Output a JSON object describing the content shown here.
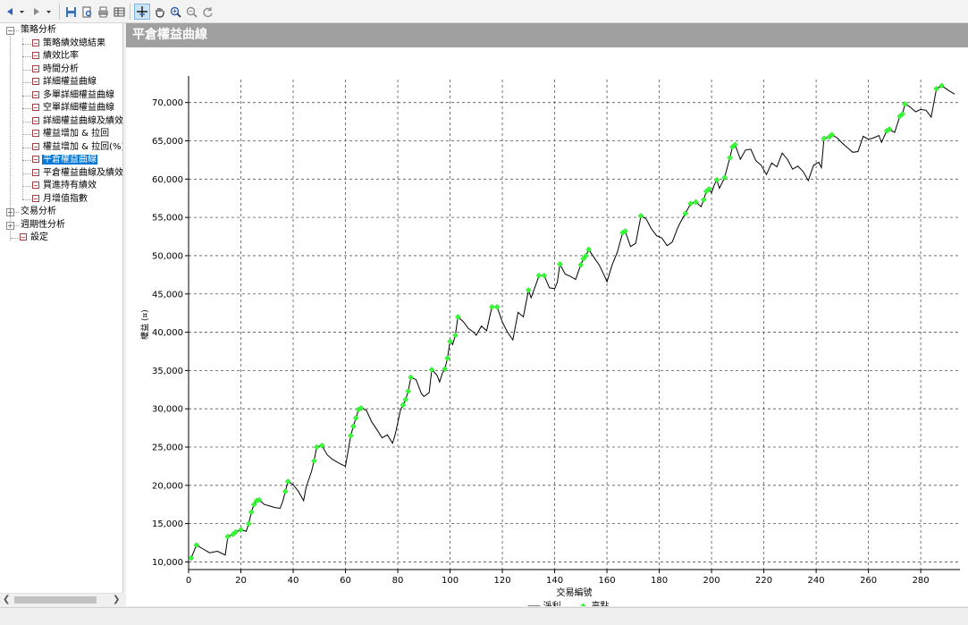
{
  "toolbar": {
    "buttons": [
      {
        "name": "back-button",
        "icon": "arrow-left-icon"
      },
      {
        "name": "back-dropdown",
        "icon": "chevron-down-icon"
      },
      {
        "name": "forward-button",
        "icon": "arrow-right-icon"
      },
      {
        "name": "forward-dropdown",
        "icon": "chevron-down-icon"
      },
      {
        "name": "save-button",
        "icon": "save-icon"
      },
      {
        "name": "print-preview-button",
        "icon": "print-preview-icon"
      },
      {
        "name": "print-button",
        "icon": "printer-icon"
      },
      {
        "name": "data-table-button",
        "icon": "table-icon"
      },
      {
        "name": "crosshair-tool-button",
        "icon": "crosshair-icon",
        "active": true
      },
      {
        "name": "pan-tool-button",
        "icon": "hand-icon"
      },
      {
        "name": "zoom-in-button",
        "icon": "zoom-in-icon"
      },
      {
        "name": "zoom-out-button",
        "icon": "zoom-out-icon"
      },
      {
        "name": "reset-view-button",
        "icon": "refresh-icon"
      }
    ]
  },
  "sidebar": {
    "tree": [
      {
        "label": "策略分析",
        "level": 0,
        "expanded": true,
        "children": [
          {
            "label": "策略績效總結果"
          },
          {
            "label": "績效比率"
          },
          {
            "label": "時間分析"
          },
          {
            "label": "詳細權益曲線"
          },
          {
            "label": "多單詳細權益曲線"
          },
          {
            "label": "空單詳細權益曲線"
          },
          {
            "label": "詳細權益曲線及績效"
          },
          {
            "label": "權益增加 & 拉回"
          },
          {
            "label": "權益增加 & 拉回(%)"
          },
          {
            "label": "平倉權益曲線",
            "selected": true
          },
          {
            "label": "平倉權益曲線及績效"
          },
          {
            "label": "買進持有績效"
          },
          {
            "label": "月增值指數"
          }
        ]
      },
      {
        "label": "交易分析",
        "level": 0,
        "expanded": false
      },
      {
        "label": "週期性分析",
        "level": 0,
        "expanded": false
      },
      {
        "label": "設定",
        "level": 0,
        "leaf": true
      }
    ]
  },
  "main": {
    "title": "平倉權益曲線"
  },
  "colors": {
    "header_bg": "#a0a0a0",
    "line": "#000000",
    "highs": "#33ff33",
    "selected": "#0078d7"
  },
  "chart_data": {
    "type": "line",
    "xlabel": "交易編號",
    "ylabel": "權益 (¤)",
    "xlim": [
      0,
      295
    ],
    "ylim": [
      9000,
      73000
    ],
    "xticks": [
      0,
      20,
      40,
      60,
      80,
      100,
      120,
      140,
      160,
      180,
      200,
      220,
      240,
      260,
      280
    ],
    "yticks": [
      10000,
      15000,
      20000,
      25000,
      30000,
      35000,
      40000,
      45000,
      50000,
      55000,
      60000,
      65000,
      70000
    ],
    "ytick_labels": [
      "10,000",
      "15,000",
      "20,000",
      "25,000",
      "30,000",
      "35,000",
      "40,000",
      "45,000",
      "50,000",
      "55,000",
      "60,000",
      "65,000",
      "70,000"
    ],
    "grid": true,
    "legend": {
      "position": "bottom-center",
      "entries": [
        {
          "label": "淨利",
          "marker": "line"
        },
        {
          "label": "高點",
          "marker": "diamond"
        }
      ]
    },
    "series": [
      {
        "name": "淨利",
        "type": "line",
        "points": [
          [
            1,
            10500
          ],
          [
            3,
            12200
          ],
          [
            5,
            11800
          ],
          [
            8,
            11200
          ],
          [
            11,
            11400
          ],
          [
            14,
            10900
          ],
          [
            15,
            13300
          ],
          [
            17,
            13600
          ],
          [
            18,
            13900
          ],
          [
            20,
            14200
          ],
          [
            22,
            14000
          ],
          [
            23,
            15000
          ],
          [
            24,
            16500
          ],
          [
            25,
            17500
          ],
          [
            26,
            18000
          ],
          [
            27,
            18100
          ],
          [
            29,
            17500
          ],
          [
            31,
            17300
          ],
          [
            33,
            17100
          ],
          [
            35,
            17000
          ],
          [
            36,
            17900
          ],
          [
            37,
            19200
          ],
          [
            38,
            20500
          ],
          [
            40,
            20100
          ],
          [
            42,
            19200
          ],
          [
            44,
            18000
          ],
          [
            45,
            19800
          ],
          [
            47,
            21800
          ],
          [
            48,
            23200
          ],
          [
            49,
            25000
          ],
          [
            51,
            25200
          ],
          [
            53,
            24000
          ],
          [
            55,
            23400
          ],
          [
            58,
            22800
          ],
          [
            60,
            22500
          ],
          [
            61,
            24500
          ],
          [
            62,
            26500
          ],
          [
            63,
            27700
          ],
          [
            64,
            28800
          ],
          [
            65,
            29900
          ],
          [
            66,
            30100
          ],
          [
            68,
            29800
          ],
          [
            70,
            28300
          ],
          [
            72,
            27300
          ],
          [
            74,
            26200
          ],
          [
            76,
            26600
          ],
          [
            78,
            25500
          ],
          [
            79,
            26600
          ],
          [
            81,
            29800
          ],
          [
            82,
            30500
          ],
          [
            83,
            31200
          ],
          [
            84,
            32300
          ],
          [
            85,
            34100
          ],
          [
            87,
            33800
          ],
          [
            89,
            32000
          ],
          [
            90,
            31600
          ],
          [
            92,
            32100
          ],
          [
            93,
            35100
          ],
          [
            95,
            34400
          ],
          [
            96,
            33500
          ],
          [
            97,
            34600
          ],
          [
            98,
            35200
          ],
          [
            99,
            36600
          ],
          [
            100,
            38800
          ],
          [
            101,
            38400
          ],
          [
            102,
            39600
          ],
          [
            103,
            42000
          ],
          [
            105,
            41400
          ],
          [
            107,
            40500
          ],
          [
            109,
            40000
          ],
          [
            110,
            39600
          ],
          [
            112,
            40800
          ],
          [
            114,
            40200
          ],
          [
            116,
            43300
          ],
          [
            118,
            43300
          ],
          [
            120,
            41300
          ],
          [
            122,
            40000
          ],
          [
            124,
            39000
          ],
          [
            126,
            42600
          ],
          [
            128,
            42000
          ],
          [
            130,
            45500
          ],
          [
            131,
            44500
          ],
          [
            133,
            46400
          ],
          [
            134,
            47400
          ],
          [
            136,
            47400
          ],
          [
            138,
            45800
          ],
          [
            140,
            45700
          ],
          [
            141,
            46500
          ],
          [
            142,
            48900
          ],
          [
            144,
            47600
          ],
          [
            146,
            47300
          ],
          [
            148,
            46900
          ],
          [
            150,
            48800
          ],
          [
            151,
            49600
          ],
          [
            152,
            50000
          ],
          [
            153,
            50800
          ],
          [
            155,
            49800
          ],
          [
            157,
            48800
          ],
          [
            159,
            47400
          ],
          [
            160,
            46600
          ],
          [
            162,
            48800
          ],
          [
            164,
            50500
          ],
          [
            166,
            53000
          ],
          [
            167,
            53200
          ],
          [
            169,
            51200
          ],
          [
            171,
            51600
          ],
          [
            173,
            55200
          ],
          [
            175,
            54800
          ],
          [
            177,
            53500
          ],
          [
            179,
            52600
          ],
          [
            181,
            52300
          ],
          [
            183,
            51300
          ],
          [
            185,
            51800
          ],
          [
            187,
            53600
          ],
          [
            188,
            54300
          ],
          [
            190,
            55500
          ],
          [
            192,
            56800
          ],
          [
            194,
            57000
          ],
          [
            196,
            56400
          ],
          [
            197,
            57300
          ],
          [
            198,
            58400
          ],
          [
            199,
            58700
          ],
          [
            200,
            58200
          ],
          [
            201,
            59200
          ],
          [
            202,
            59900
          ],
          [
            203,
            58800
          ],
          [
            205,
            60200
          ],
          [
            207,
            62800
          ],
          [
            208,
            64200
          ],
          [
            209,
            64500
          ],
          [
            211,
            62600
          ],
          [
            213,
            63800
          ],
          [
            215,
            63900
          ],
          [
            217,
            62400
          ],
          [
            219,
            61800
          ],
          [
            221,
            60600
          ],
          [
            223,
            62100
          ],
          [
            225,
            61600
          ],
          [
            227,
            63400
          ],
          [
            229,
            62600
          ],
          [
            231,
            61300
          ],
          [
            233,
            61700
          ],
          [
            235,
            61000
          ],
          [
            237,
            59800
          ],
          [
            239,
            61800
          ],
          [
            241,
            62200
          ],
          [
            242,
            61500
          ],
          [
            243,
            65300
          ],
          [
            245,
            65500
          ],
          [
            246,
            65800
          ],
          [
            248,
            65400
          ],
          [
            250,
            64700
          ],
          [
            252,
            64100
          ],
          [
            254,
            63500
          ],
          [
            256,
            63600
          ],
          [
            258,
            65600
          ],
          [
            260,
            65200
          ],
          [
            262,
            65400
          ],
          [
            264,
            65700
          ],
          [
            265,
            64800
          ],
          [
            267,
            66300
          ],
          [
            268,
            66500
          ],
          [
            270,
            66100
          ],
          [
            272,
            68200
          ],
          [
            273,
            68500
          ],
          [
            274,
            69800
          ],
          [
            276,
            69400
          ],
          [
            278,
            68800
          ],
          [
            280,
            69100
          ],
          [
            282,
            69000
          ],
          [
            284,
            68100
          ],
          [
            286,
            71800
          ],
          [
            288,
            72200
          ],
          [
            291,
            71500
          ],
          [
            293,
            71100
          ]
        ]
      },
      {
        "name": "高點",
        "type": "scatter",
        "points": [
          [
            1,
            10500
          ],
          [
            3,
            12200
          ],
          [
            15,
            13300
          ],
          [
            17,
            13600
          ],
          [
            18,
            13900
          ],
          [
            20,
            14200
          ],
          [
            23,
            15000
          ],
          [
            24,
            16500
          ],
          [
            25,
            17500
          ],
          [
            26,
            18000
          ],
          [
            27,
            18100
          ],
          [
            37,
            19200
          ],
          [
            38,
            20500
          ],
          [
            48,
            23200
          ],
          [
            49,
            25000
          ],
          [
            51,
            25200
          ],
          [
            62,
            26500
          ],
          [
            63,
            27700
          ],
          [
            64,
            28800
          ],
          [
            65,
            29900
          ],
          [
            66,
            30100
          ],
          [
            82,
            30500
          ],
          [
            83,
            31200
          ],
          [
            84,
            32300
          ],
          [
            85,
            34100
          ],
          [
            93,
            35100
          ],
          [
            98,
            35200
          ],
          [
            99,
            36600
          ],
          [
            100,
            38800
          ],
          [
            102,
            39600
          ],
          [
            103,
            42000
          ],
          [
            116,
            43300
          ],
          [
            118,
            43300
          ],
          [
            130,
            45500
          ],
          [
            134,
            47400
          ],
          [
            136,
            47400
          ],
          [
            142,
            48900
          ],
          [
            150,
            48800
          ],
          [
            151,
            49600
          ],
          [
            152,
            50000
          ],
          [
            153,
            50800
          ],
          [
            166,
            53000
          ],
          [
            167,
            53200
          ],
          [
            173,
            55200
          ],
          [
            190,
            55500
          ],
          [
            192,
            56800
          ],
          [
            194,
            57000
          ],
          [
            197,
            57300
          ],
          [
            198,
            58400
          ],
          [
            199,
            58700
          ],
          [
            202,
            59900
          ],
          [
            205,
            60200
          ],
          [
            207,
            62800
          ],
          [
            208,
            64200
          ],
          [
            209,
            64500
          ],
          [
            243,
            65300
          ],
          [
            245,
            65500
          ],
          [
            246,
            65800
          ],
          [
            267,
            66300
          ],
          [
            268,
            66500
          ],
          [
            272,
            68200
          ],
          [
            273,
            68500
          ],
          [
            274,
            69800
          ],
          [
            286,
            71800
          ],
          [
            288,
            72200
          ]
        ]
      }
    ]
  }
}
